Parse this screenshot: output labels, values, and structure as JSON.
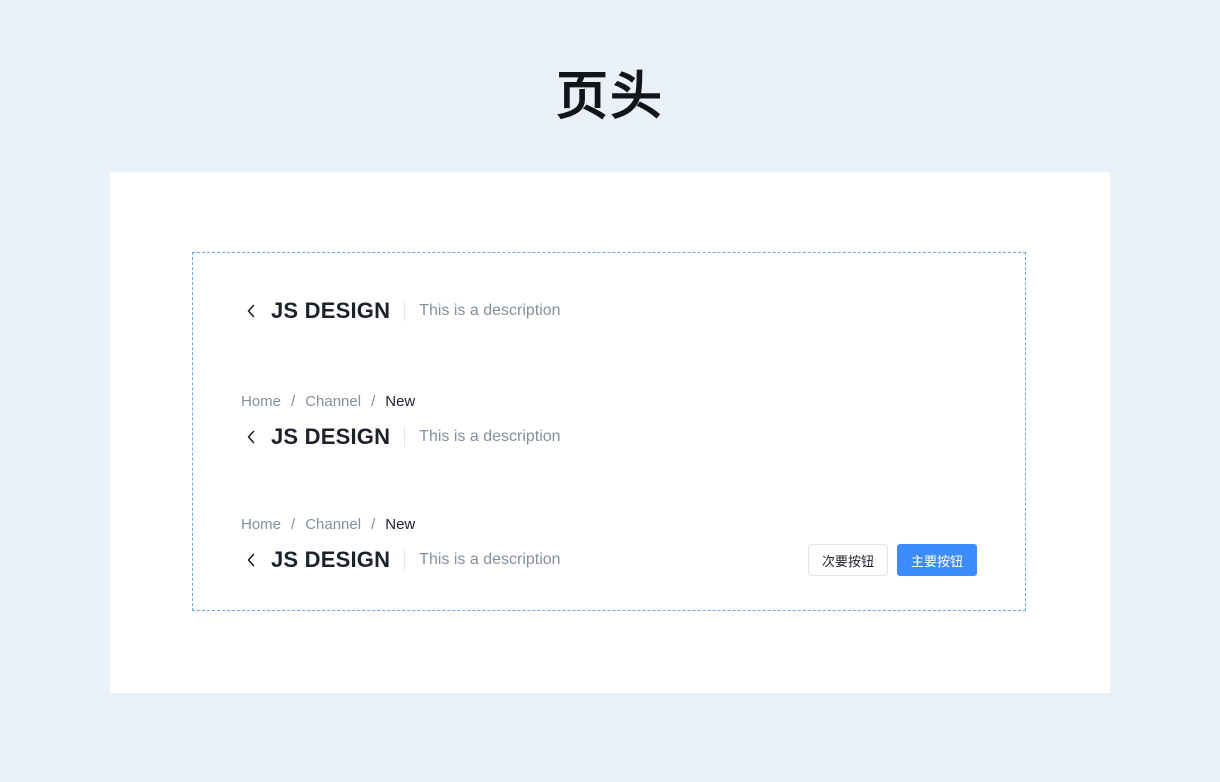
{
  "page": {
    "heading": "页头"
  },
  "headers": [
    {
      "title": "JS DESIGN",
      "description": "This is a description"
    },
    {
      "breadcrumb": [
        "Home",
        "Channel",
        "New"
      ],
      "separator": "/",
      "title": "JS DESIGN",
      "description": "This is a description"
    },
    {
      "breadcrumb": [
        "Home",
        "Channel",
        "New"
      ],
      "separator": "/",
      "title": "JS DESIGN",
      "description": "This is a description",
      "actions": {
        "secondary_label": "次要按钮",
        "primary_label": "主要按钮"
      }
    }
  ],
  "colors": {
    "background": "#eaf0f7",
    "card": "#ffffff",
    "frame_border": "#6fa8dc",
    "primary": "#3c8cff",
    "text_primary": "#1d2129",
    "text_secondary": "#86909c"
  },
  "icons": {
    "back": "chevron-left-icon"
  }
}
